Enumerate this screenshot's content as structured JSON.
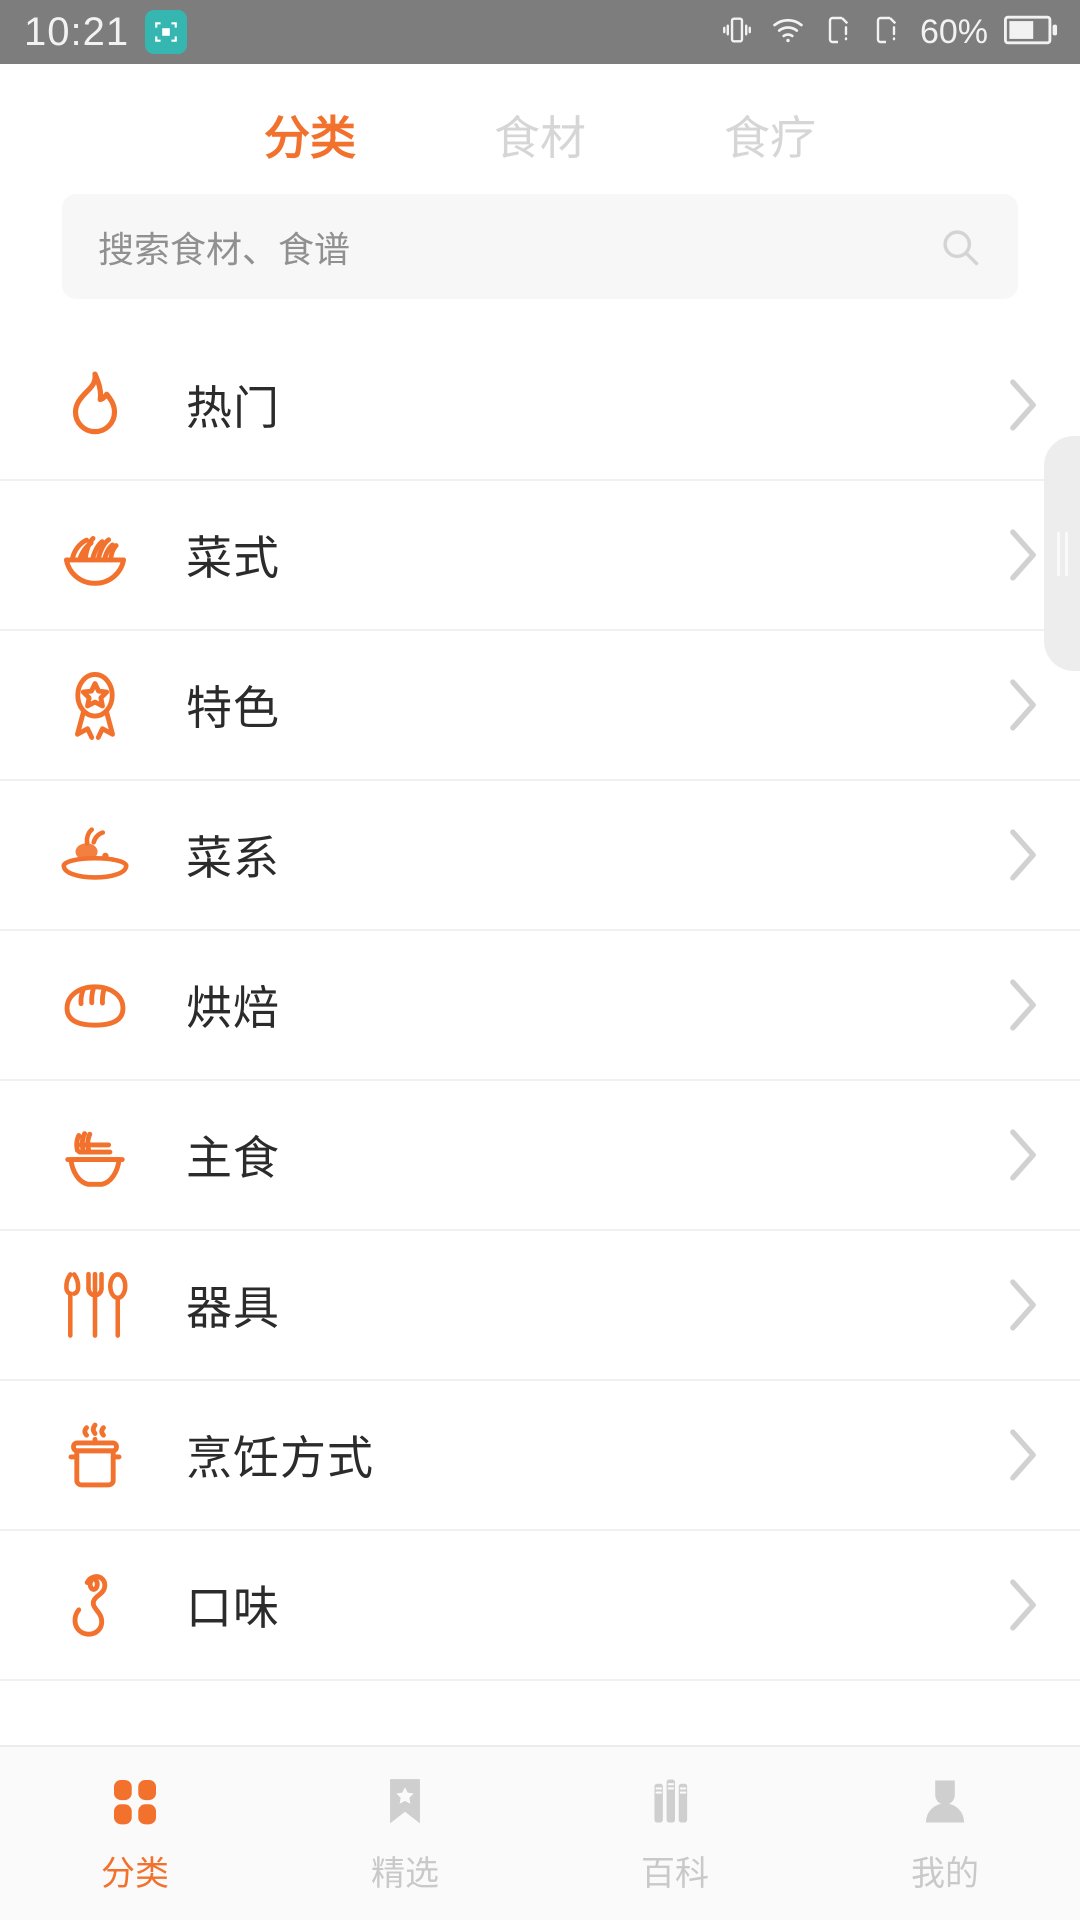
{
  "statusbar": {
    "time": "10:21",
    "battery_pct": "60%",
    "badge_icon": "scan-frame-icon",
    "icons": [
      "vibrate-icon",
      "wifi-icon",
      "sim1-alert-icon",
      "sim2-alert-icon",
      "battery-icon"
    ]
  },
  "colors": {
    "accent": "#f2712c",
    "statusbar_bg": "#7d7d7d",
    "badge_teal": "#36b6b0",
    "inactive_text": "#d6d6d6",
    "row_text": "#2b2b2b",
    "search_bg": "#f7f7f7"
  },
  "tabs": [
    {
      "label": "分类",
      "active": true
    },
    {
      "label": "食材",
      "active": false
    },
    {
      "label": "食疗",
      "active": false
    }
  ],
  "search": {
    "placeholder": "搜索食材、食谱",
    "value": "",
    "icon": "search-icon"
  },
  "list": [
    {
      "label": "热门",
      "icon": "flame-icon"
    },
    {
      "label": "菜式",
      "icon": "salad-bowl-icon"
    },
    {
      "label": "特色",
      "icon": "award-medal-icon"
    },
    {
      "label": "菜系",
      "icon": "plated-dish-icon"
    },
    {
      "label": "烘焙",
      "icon": "bread-loaf-icon"
    },
    {
      "label": "主食",
      "icon": "noodle-bowl-icon"
    },
    {
      "label": "器具",
      "icon": "cutlery-icon"
    },
    {
      "label": "烹饪方式",
      "icon": "steaming-pot-icon"
    },
    {
      "label": "口味",
      "icon": "chili-pepper-icon"
    }
  ],
  "bottom_nav": [
    {
      "label": "分类",
      "icon": "grid-icon",
      "active": true
    },
    {
      "label": "精选",
      "icon": "bookmark-star-icon",
      "active": false
    },
    {
      "label": "百科",
      "icon": "books-icon",
      "active": false
    },
    {
      "label": "我的",
      "icon": "person-icon",
      "active": false
    }
  ]
}
